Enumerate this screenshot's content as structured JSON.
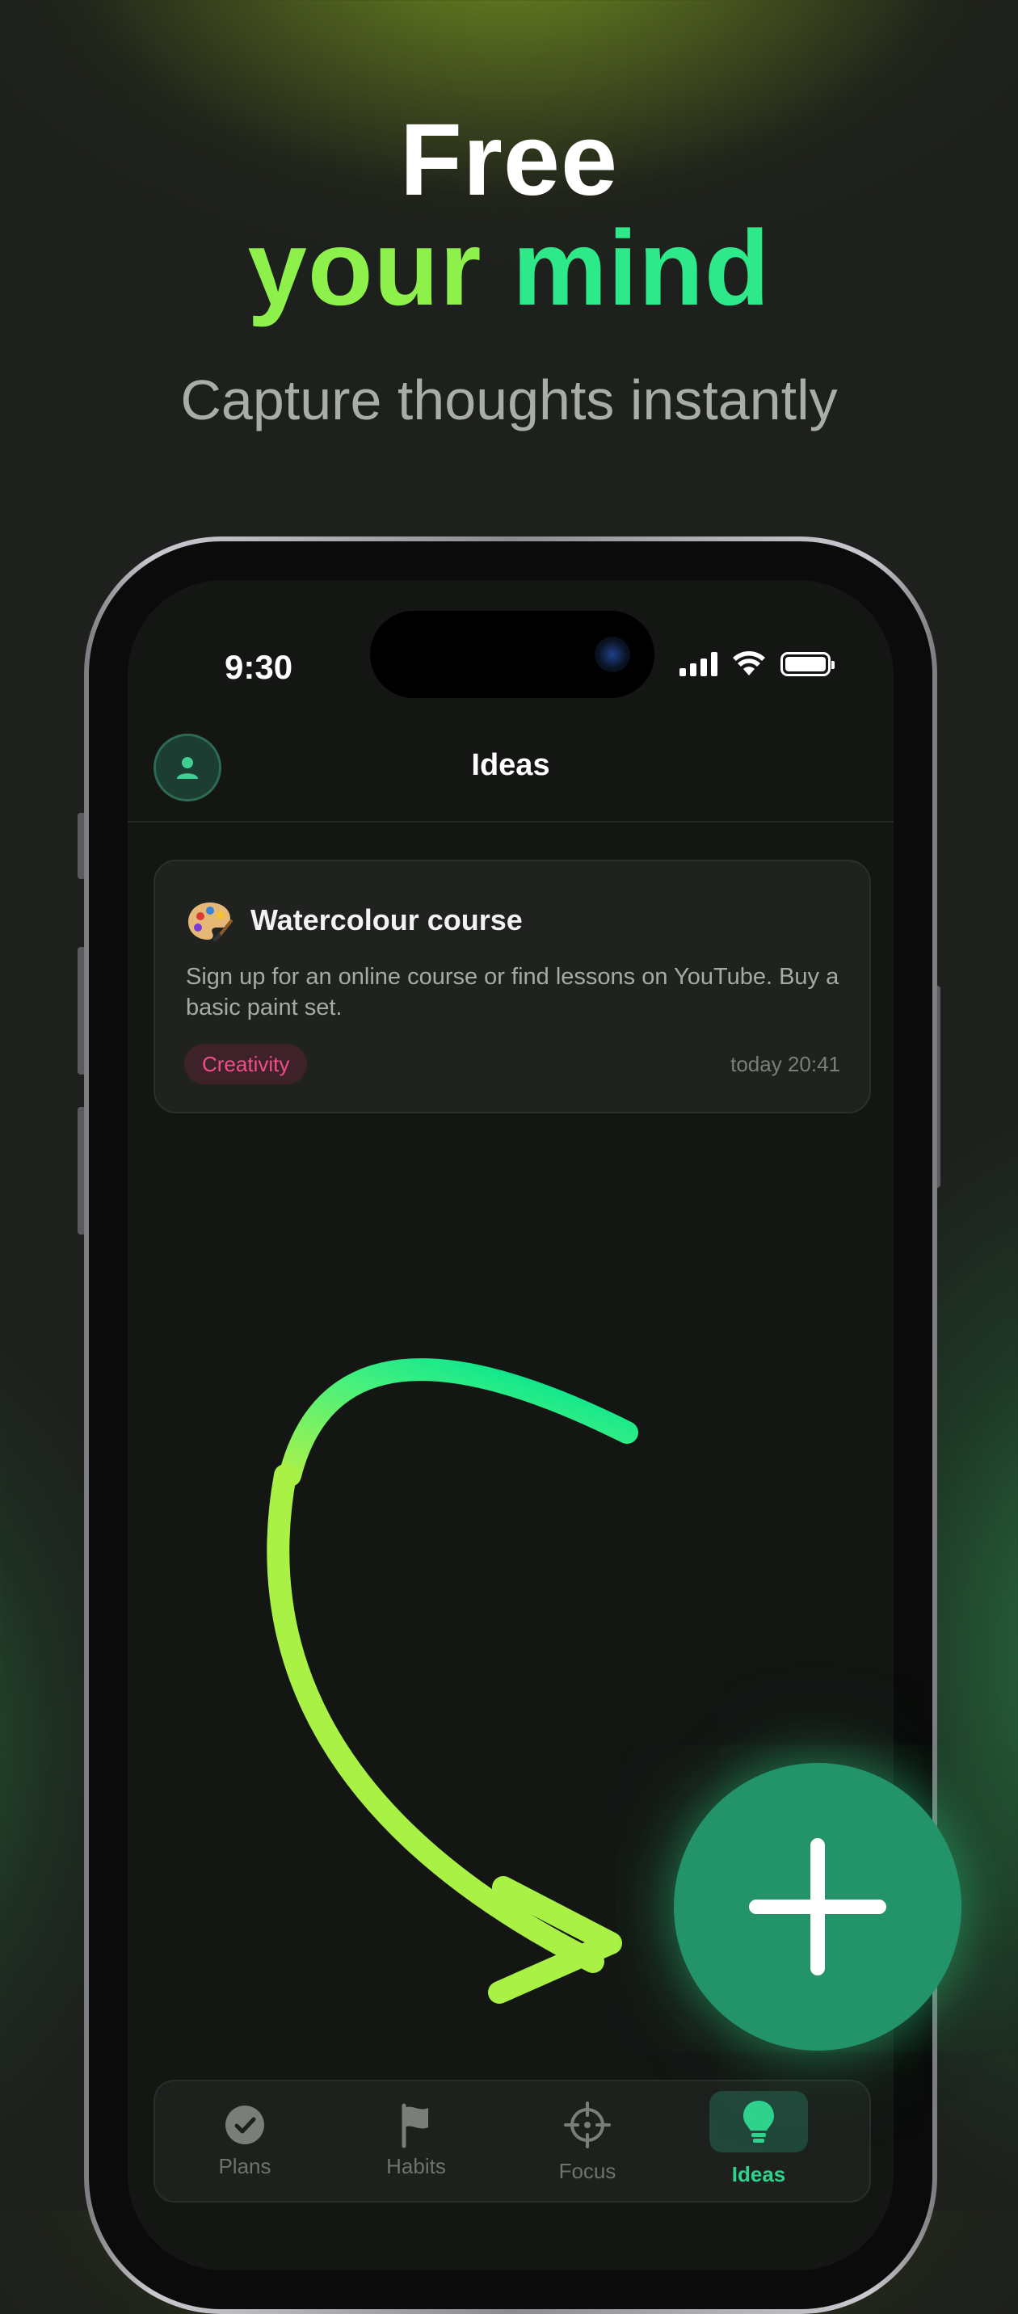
{
  "hero": {
    "line1": "Free",
    "line2_part1": "your",
    "line2_part2": "mind",
    "subtitle": "Capture thoughts instantly"
  },
  "status_bar": {
    "time": "9:30"
  },
  "header": {
    "title": "Ideas",
    "avatar_icon": "person-icon"
  },
  "ideas": [
    {
      "emoji_icon": "palette-icon",
      "title": "Watercolour course",
      "description": "Sign up for an online course or find lessons on YouTube. Buy a basic paint set.",
      "tag": "Creativity",
      "timestamp": "today 20:41"
    }
  ],
  "tabs": [
    {
      "label": "Plans",
      "icon": "check-circle-icon",
      "active": false
    },
    {
      "label": "Habits",
      "icon": "flag-icon",
      "active": false
    },
    {
      "label": "Focus",
      "icon": "crosshair-icon",
      "active": false
    },
    {
      "label": "Ideas",
      "icon": "lightbulb-icon",
      "active": true
    }
  ],
  "fab": {
    "icon": "plus-icon"
  },
  "colors": {
    "accent_green": "#2fd38d",
    "lime": "#8ef04a",
    "fab": "#23936a",
    "tag_text": "#ef4f86",
    "tag_bg": "#3e2229"
  }
}
